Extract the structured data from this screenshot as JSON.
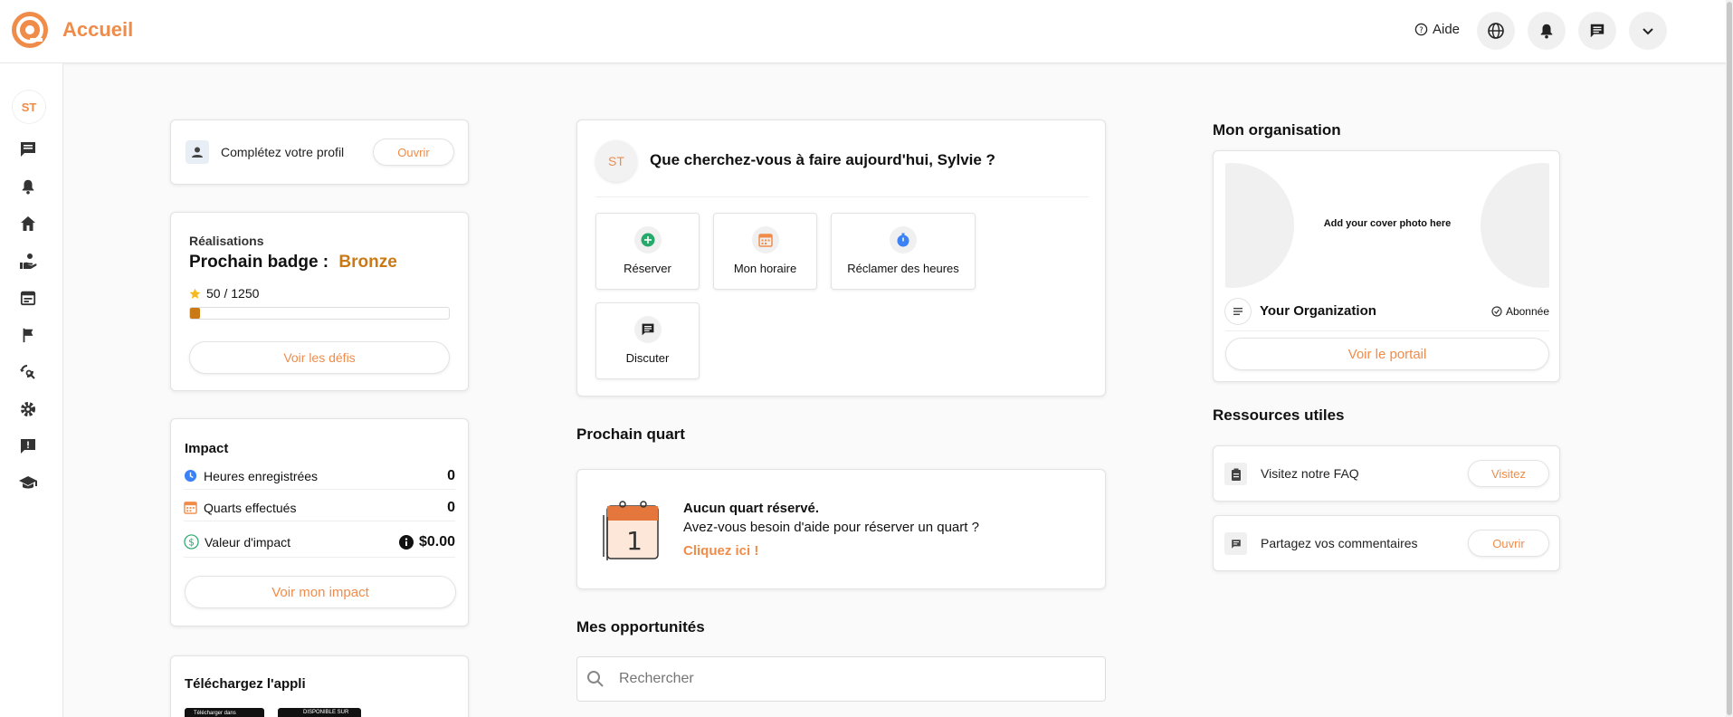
{
  "app": {
    "title": "Accueil"
  },
  "header": {
    "help_label": "Aide"
  },
  "sidebar": {
    "avatar_initials": "ST"
  },
  "profile": {
    "label": "Complétez votre profil",
    "button": "Ouvrir"
  },
  "achievements": {
    "heading": "Réalisations",
    "next_badge_label": "Prochain badge :",
    "badge_name": "Bronze",
    "points": "50 / 1250",
    "progress_fraction": 0.04,
    "button": "Voir les défis"
  },
  "impact": {
    "heading": "Impact",
    "rows": [
      {
        "label": "Heures enregistrées",
        "value": "0"
      },
      {
        "label": "Quarts effectués",
        "value": "0"
      },
      {
        "label": "Valeur d'impact",
        "value": "$0.00"
      }
    ],
    "button": "Voir mon impact"
  },
  "app_download": {
    "heading": "Téléchargez l'appli",
    "apple_badge": "Télécharger dans",
    "google_badge": "DISPONIBLE SUR"
  },
  "welcome": {
    "avatar_initials": "ST",
    "question": "Que cherchez-vous à faire aujourd'hui, Sylvie ?",
    "actions": [
      {
        "label": "Réserver"
      },
      {
        "label": "Mon horaire"
      },
      {
        "label": "Réclamer des heures"
      },
      {
        "label": "Discuter"
      }
    ]
  },
  "next_shift": {
    "title": "Prochain quart",
    "empty_title": "Aucun quart réservé.",
    "empty_text": "Avez-vous besoin d'aide pour réserver un quart ?",
    "link": "Cliquez ici !",
    "calendar_number": "1"
  },
  "opportunities": {
    "title": "Mes opportunités",
    "search_placeholder": "Rechercher"
  },
  "organization": {
    "title": "Mon organisation",
    "cover_text": "Add your cover photo here",
    "name": "Your Organization",
    "status": "Abonnée",
    "button": "Voir le portail"
  },
  "resources": {
    "title": "Ressources utiles",
    "items": [
      {
        "label": "Visitez notre FAQ",
        "button": "Visitez"
      },
      {
        "label": "Partagez vos commentaires",
        "button": "Ouvrir"
      }
    ]
  },
  "colors": {
    "accent": "#f08c4a",
    "badge": "#c97a16",
    "clock": "#3b82f6",
    "dollar": "#27a96b"
  }
}
